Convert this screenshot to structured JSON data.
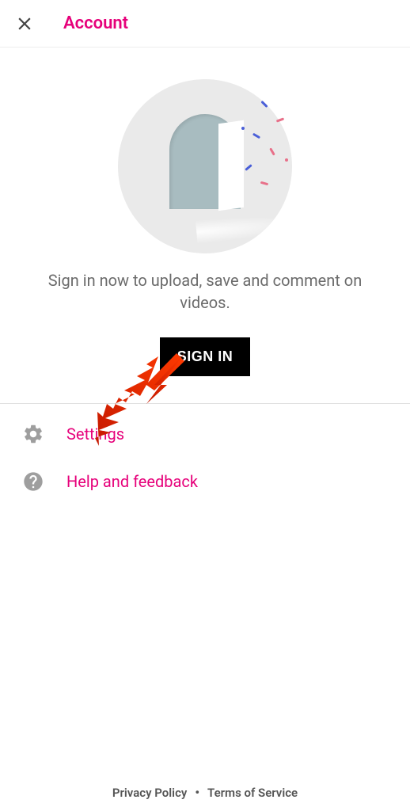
{
  "header": {
    "title": "Account"
  },
  "hero": {
    "message": "Sign in now to upload, save and comment on videos.",
    "button_label": "SIGN IN"
  },
  "menu": {
    "settings": {
      "label": "Settings",
      "icon": "gear-icon"
    },
    "help": {
      "label": "Help and feedback",
      "icon": "help-icon"
    }
  },
  "footer": {
    "privacy": "Privacy Policy",
    "terms": "Terms of Service"
  },
  "annotation": {
    "arrow_color": "#ff2a00"
  },
  "colors": {
    "accent": "#e6007a"
  }
}
